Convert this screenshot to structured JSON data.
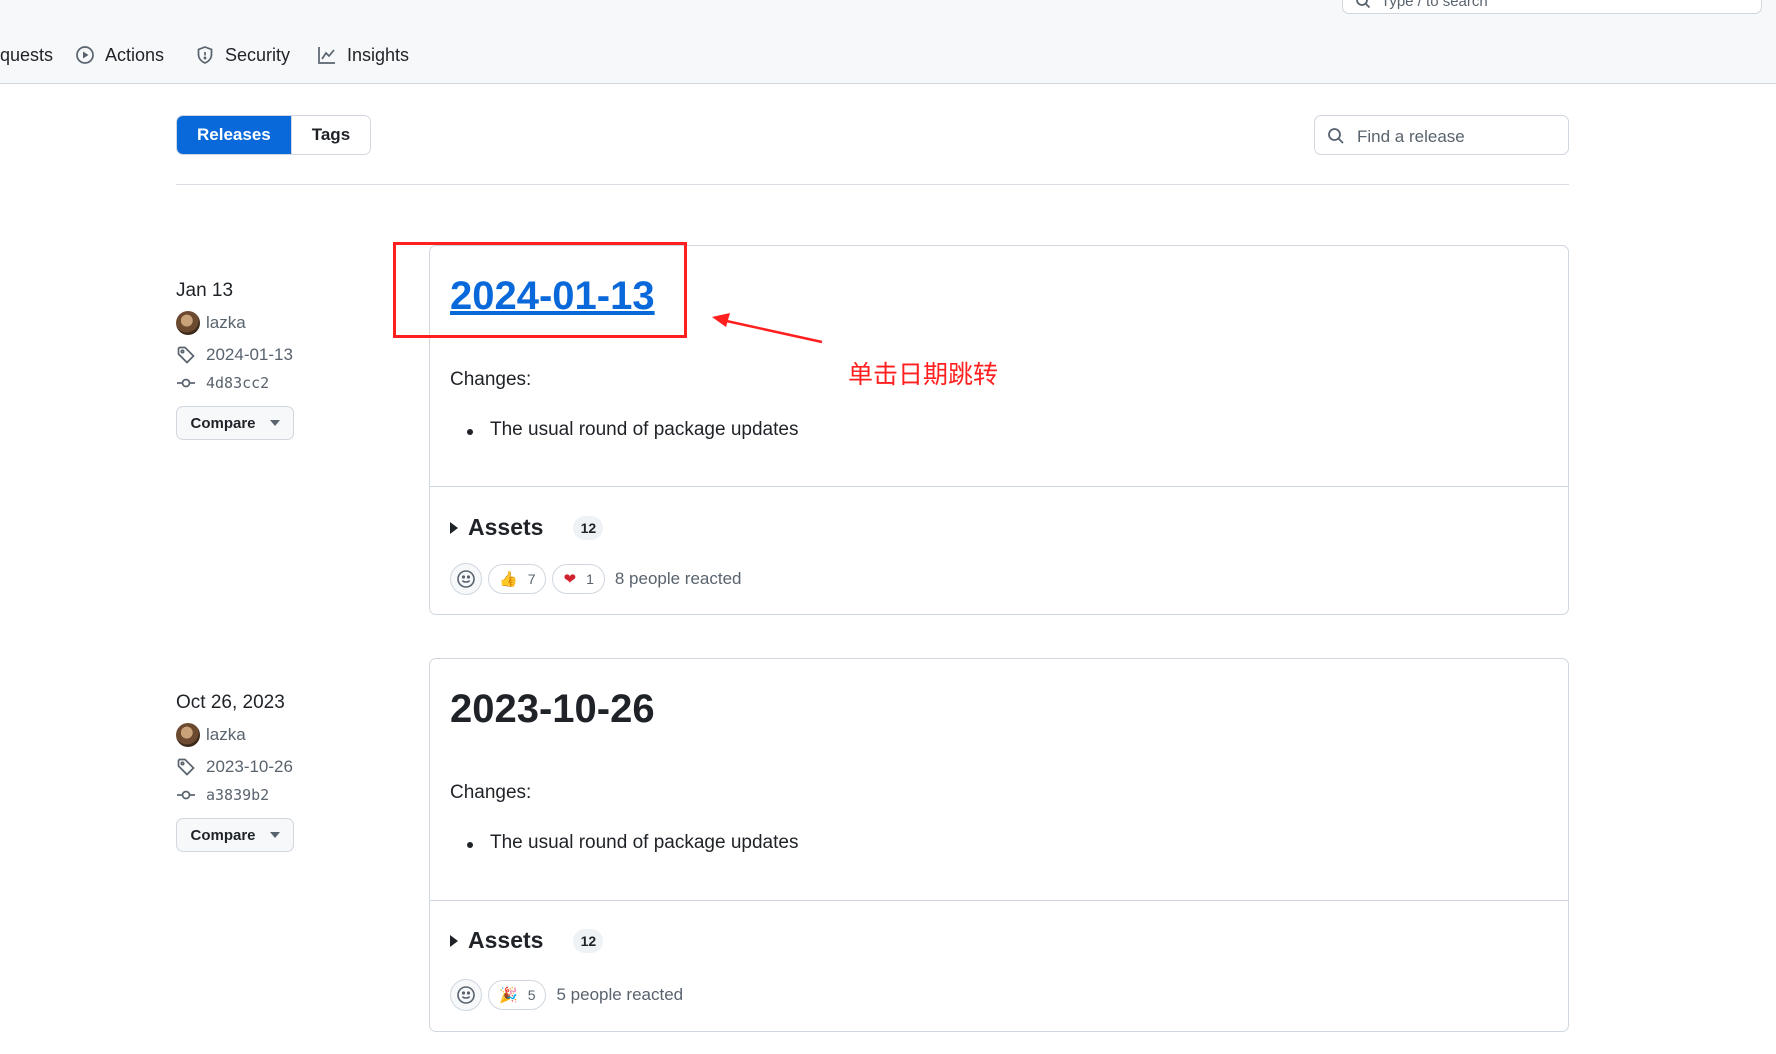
{
  "nav": {
    "items": [
      {
        "label": "quests",
        "icon": "none"
      },
      {
        "label": "Actions",
        "icon": "play-icon"
      },
      {
        "label": "Security",
        "icon": "shield-icon"
      },
      {
        "label": "Insights",
        "icon": "graph-icon"
      }
    ],
    "search_placeholder": "Type / to search"
  },
  "subheader": {
    "releases_label": "Releases",
    "tags_label": "Tags",
    "find_placeholder": "Find a release"
  },
  "releases": [
    {
      "date": "Jan 13",
      "author": "lazka",
      "tag": "2024-01-13",
      "commit": "4d83cc2",
      "compare_label": "Compare",
      "title": "2024-01-13",
      "changes_label": "Changes:",
      "changes": [
        "The usual round of package updates"
      ],
      "assets_label": "Assets",
      "assets_count": "12",
      "reactions": [
        {
          "emoji": "👍",
          "count": "7"
        },
        {
          "emoji": "❤",
          "count": "1"
        }
      ],
      "reaction_summary": "8 people reacted"
    },
    {
      "date": "Oct 26, 2023",
      "author": "lazka",
      "tag": "2023-10-26",
      "commit": "a3839b2",
      "compare_label": "Compare",
      "title": "2023-10-26",
      "changes_label": "Changes:",
      "changes": [
        "The usual round of package updates"
      ],
      "assets_label": "Assets",
      "assets_count": "12",
      "reactions": [
        {
          "emoji": "🎉",
          "count": "5"
        }
      ],
      "reaction_summary": "5 people reacted"
    }
  ],
  "annotation": {
    "text": "单击日期跳转",
    "color": "#ff1f1f"
  },
  "colors": {
    "accent": "#0969da",
    "border": "#d0d7de",
    "muted": "#59636e"
  }
}
